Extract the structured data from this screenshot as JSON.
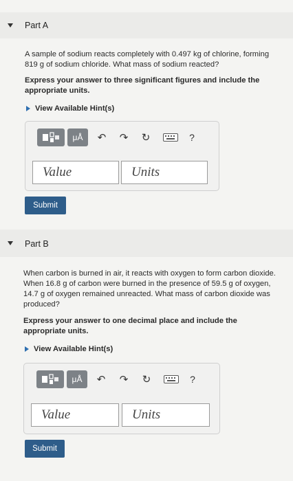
{
  "part_a": {
    "title": "Part A",
    "problem": "A sample of sodium reacts completely with 0.497 kg of chlorine, forming 819 g of sodium chloride. What mass of sodium reacted?",
    "instruction": "Express your answer to three significant figures and include the appropriate units.",
    "hint_label": "View Available Hint(s)",
    "value_placeholder": "Value",
    "units_placeholder": "Units",
    "submit_label": "Submit"
  },
  "part_b": {
    "title": "Part B",
    "problem": "When carbon is burned in air, it reacts with oxygen to form carbon dioxide. When 16.8 g of carbon were burned in the presence of 59.5 g of oxygen, 14.7 g of oxygen remained unreacted. What mass of carbon dioxide was produced?",
    "instruction": "Express your answer to one decimal place and include the appropriate units.",
    "hint_label": "View Available Hint(s)",
    "value_placeholder": "Value",
    "units_placeholder": "Units",
    "submit_label": "Submit"
  },
  "toolbar": {
    "units_symbol": "μÅ",
    "help": "?",
    "icons": [
      "templates-icon",
      "units-icon",
      "undo-icon",
      "redo-icon",
      "reset-icon",
      "keyboard-icon",
      "help-icon"
    ]
  }
}
